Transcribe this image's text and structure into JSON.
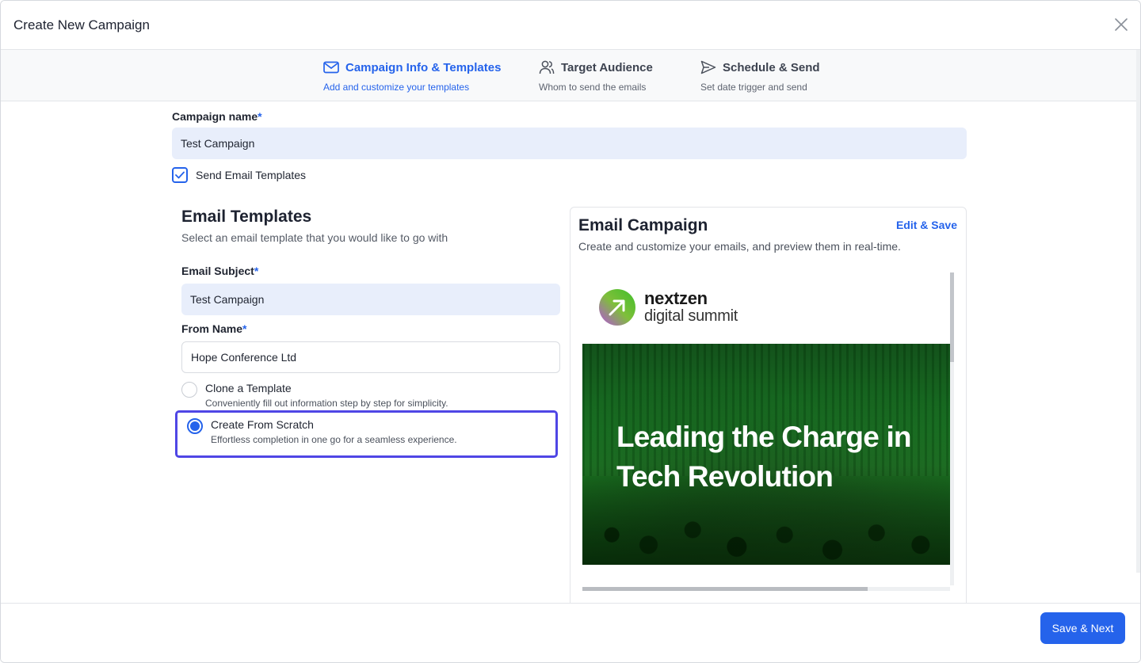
{
  "modal": {
    "title": "Create New Campaign"
  },
  "stepper": {
    "steps": [
      {
        "title": "Campaign Info & Templates",
        "subtitle": "Add and customize your templates",
        "icon": "mail-icon",
        "active": true
      },
      {
        "title": "Target Audience",
        "subtitle": "Whom to send the emails",
        "icon": "users-icon",
        "active": false
      },
      {
        "title": "Schedule & Send",
        "subtitle": "Set date trigger and send",
        "icon": "send-icon",
        "active": false
      }
    ]
  },
  "form": {
    "campaign_name_label": "Campaign name",
    "required_mark": "*",
    "campaign_name_value": "Test Campaign",
    "send_templates_label": "Send Email Templates",
    "send_templates_checked": true
  },
  "templates": {
    "title": "Email Templates",
    "subtitle": "Select an email template that you would like to go with",
    "subject_label": "Email Subject",
    "subject_value": "Test Campaign",
    "from_label": "From Name",
    "from_value": "Hope Conference Ltd",
    "options": [
      {
        "title": "Clone a Template",
        "description": "Conveniently fill out information step by step for simplicity.",
        "selected": false
      },
      {
        "title": "Create From Scratch",
        "description": "Effortless completion in one go for a seamless experience.",
        "selected": true
      }
    ]
  },
  "preview": {
    "title": "Email Campaign",
    "edit_label": "Edit & Save",
    "subtitle": "Create and customize your emails, and preview them in real-time.",
    "logo_line1": "nextzen",
    "logo_line2": "digital summit",
    "hero_text": "Leading the Charge in Tech Revolution"
  },
  "footer": {
    "save_next_label": "Save & Next"
  },
  "colors": {
    "accent": "#2563eb",
    "selection_border": "#4f46e5",
    "filled_input": "#e8eefb"
  }
}
